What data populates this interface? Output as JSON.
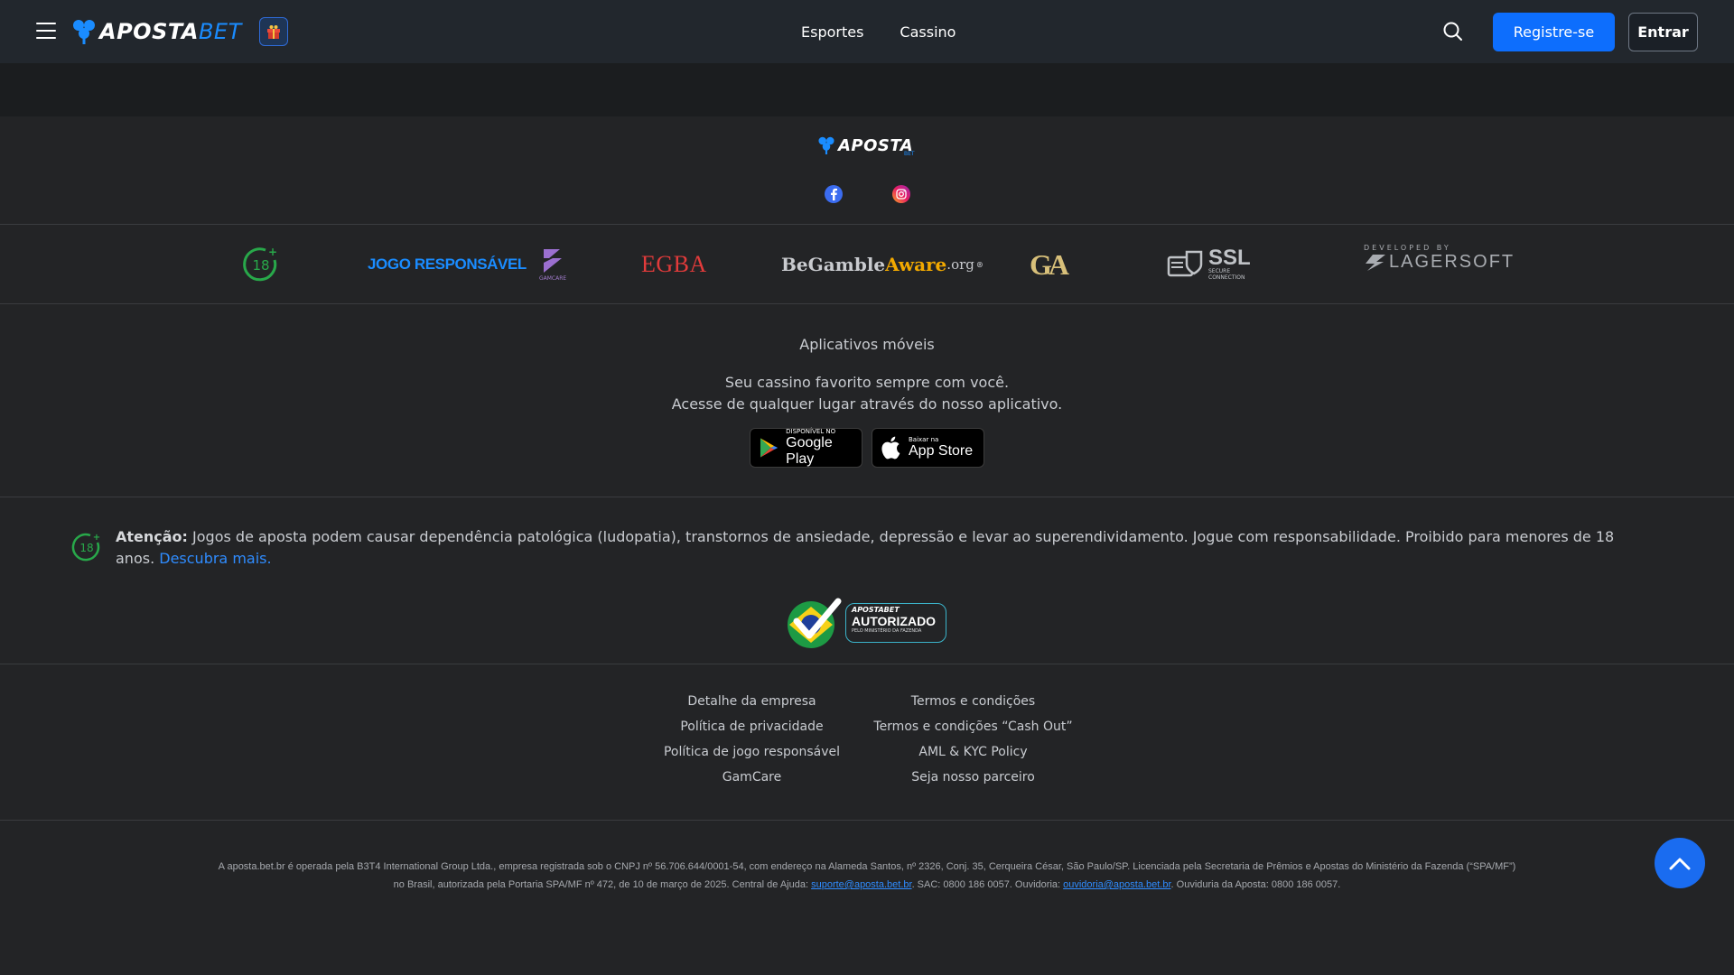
{
  "header": {
    "logo_word_white": "APOSTA",
    "logo_word_blue": "BET",
    "nav": [
      "Esportes",
      "Cassino"
    ],
    "register_label": "Registre-se",
    "login_label": "Entrar"
  },
  "footer_logo": {
    "word": "APOSTA",
    "sub": "BET"
  },
  "partners": {
    "age": "18",
    "jogo": "JOGO RESPONSÁVEL",
    "gamcare": "GAMCARE",
    "egba": "EGBA",
    "begamble": {
      "be": "BeGamble",
      "aware": "Aware",
      "org": ".org",
      "reg": "®"
    },
    "ga": "GA",
    "ssl": {
      "title": "SSL",
      "sub1": "SECURE",
      "sub2": "CONNECTION"
    },
    "lager": {
      "dev": "DEVELOPED BY",
      "name": "LAGERSOFT"
    }
  },
  "apps": {
    "title": "Aplicativos móveis",
    "line1": "Seu cassino favorito sempre com você.",
    "line2": "Acesse de qualquer lugar através do nosso aplicativo.",
    "google": {
      "small": "DISPONÍVEL NO",
      "big": "Google Play"
    },
    "apple": {
      "small": "Baixar na",
      "big": "App Store"
    }
  },
  "warning": {
    "age": "18",
    "label": "Atenção:",
    "text": " Jogos de aposta podem causar dependência patológica (ludopatia), transtornos de ansiedade, depressão e levar ao superendividamento. Jogue com responsabilidade. Proibido para menores de 18 anos. ",
    "link": "Descubra mais."
  },
  "badge": {
    "brand": "APOSTABET",
    "title": "AUTORIZADO",
    "sub": "PELO MINISTÉRIO DA FAZENDA"
  },
  "links": {
    "col1": [
      "Detalhe da empresa",
      "Política de privacidade",
      "Política de jogo responsável",
      "GamCare"
    ],
    "col2": [
      "Termos e condições",
      "Termos e condições “Cash Out”",
      "AML & KYC Policy",
      "Seja nosso parceiro"
    ]
  },
  "legal": {
    "line1": "A aposta.bet.br é operada pela B3T4 International Group Ltda., empresa registrada sob o CNPJ nº 56.706.644/0001-54, com endereço na Alameda Santos, nº 2326, Conj. 35, Cerqueira César, São Paulo/SP. Licenciada pela Secretaria de Prêmios e Apostas do Ministério da Fazenda (“SPA/MF”)",
    "line2a": "no Brasil, autorizada pela Portaria SPA/MF nº 472, de 10 de março de 2025. Central de Ajuda: ",
    "email1": "suporte@aposta.bet.br",
    "line2b": ". SAC: 0800 186 0057. Ouvidoria: ",
    "email2": "ouvidoria@aposta.bet.br",
    "line2c": ". Ouviduria da Aposta: 0800 186 0057."
  },
  "colors": {
    "accent": "#0d6efd",
    "header_bg": "#22272d",
    "page_bg": "#232426"
  },
  "icons": [
    "menu-icon",
    "clover-logo-icon",
    "gift-icon",
    "search-icon",
    "facebook-icon",
    "instagram-icon",
    "play-store-icon",
    "apple-icon",
    "age-18-icon",
    "chevron-up-icon"
  ]
}
